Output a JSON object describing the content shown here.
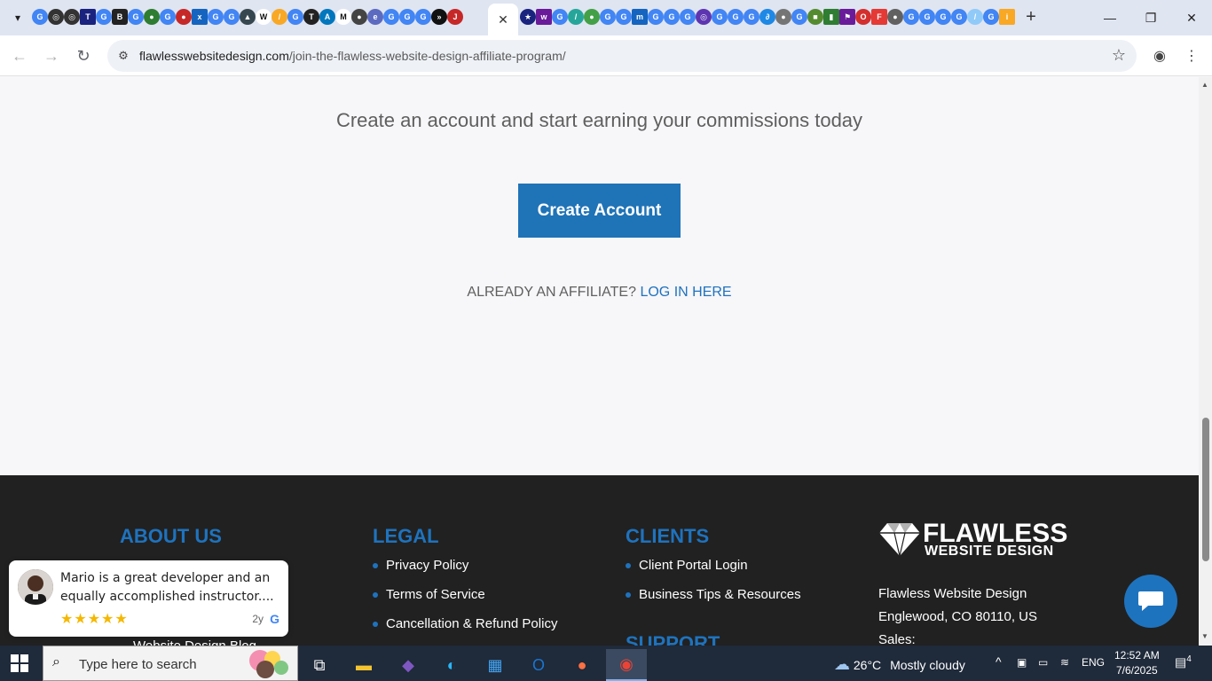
{
  "browser": {
    "url_domain": "flawlesswebsitedesign.com",
    "url_path": "/join-the-flawless-website-design-affiliate-program/",
    "active_tab_close": "✕",
    "new_tab": "+"
  },
  "page": {
    "headline": "Create an account and start earning your commissions today",
    "create_button": "Create Account",
    "already_prefix": "ALREADY AN AFFILIATE?",
    "login_link": "LOG IN HERE"
  },
  "footer": {
    "about_heading": "ABOUT US",
    "legal_heading": "LEGAL",
    "legal_items": [
      "Privacy Policy",
      "Terms of Service",
      "Cancellation & Refund Policy"
    ],
    "clients_heading": "CLIENTS",
    "clients_items": [
      "Client Portal Login",
      "Business Tips & Resources"
    ],
    "support_heading": "SUPPORT",
    "logo_line1": "FLAWLESS",
    "logo_line2": "WEBSITE DESIGN",
    "address_name": "Flawless Website Design",
    "address_city": "Englewood, CO 80110, US",
    "sales_label": "Sales:",
    "behind_text": "Website Design Blog"
  },
  "review": {
    "text": "Mario is a great developer and an equally accomplished instructor....",
    "stars": "★★★★★",
    "age": "2y",
    "rating": 5
  },
  "taskbar": {
    "search_placeholder": "Type here to search",
    "temperature": "26°C",
    "weather": "Mostly cloudy",
    "language": "ENG",
    "time": "12:52 AM",
    "date": "7/6/2025",
    "notifications": "4"
  },
  "colors": {
    "accent_blue": "#1e73be",
    "button_blue": "#1f73b7",
    "footer_bg": "#212121",
    "star_color": "#f5b800"
  }
}
